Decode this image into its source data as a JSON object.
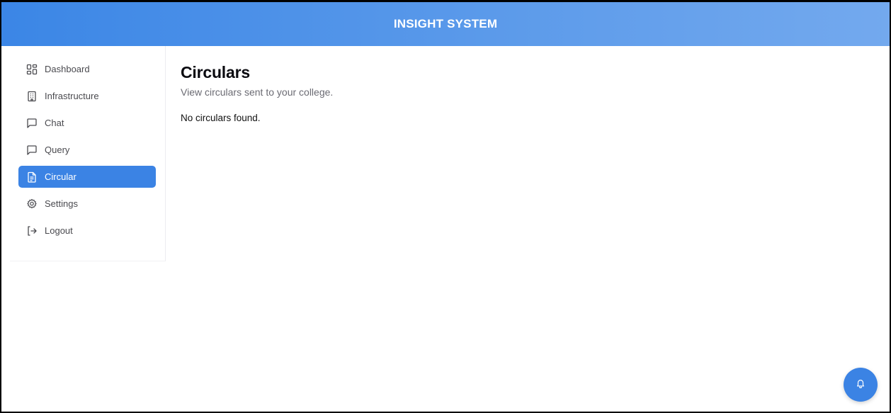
{
  "header": {
    "title": "INSIGHT SYSTEM"
  },
  "sidebar": {
    "items": [
      {
        "label": "Dashboard",
        "icon": "dashboard-grid-icon"
      },
      {
        "label": "Infrastructure",
        "icon": "building-icon"
      },
      {
        "label": "Chat",
        "icon": "message-square-icon"
      },
      {
        "label": "Query",
        "icon": "message-square-icon"
      },
      {
        "label": "Circular",
        "icon": "document-icon",
        "active": true
      },
      {
        "label": "Settings",
        "icon": "gear-icon"
      },
      {
        "label": "Logout",
        "icon": "logout-icon"
      }
    ]
  },
  "main": {
    "title": "Circulars",
    "subtitle": "View circulars sent to your college.",
    "empty_message": "No circulars found."
  },
  "fab": {
    "icon": "bell-icon"
  },
  "colors": {
    "accent": "#3b83e4",
    "header_gradient_start": "#3b86e6",
    "header_gradient_end": "#73a9ee"
  }
}
